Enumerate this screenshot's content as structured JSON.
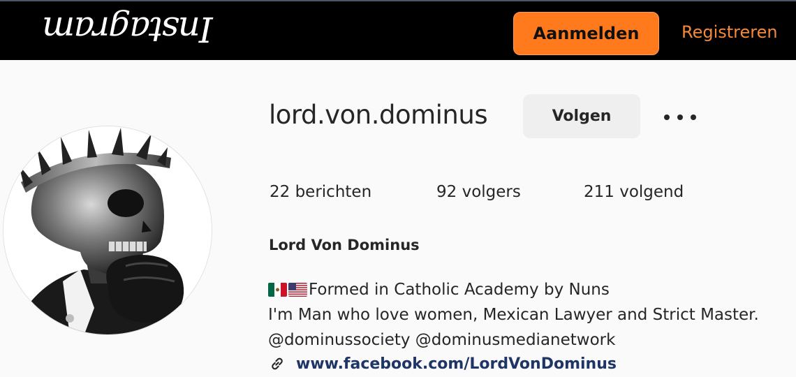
{
  "header": {
    "logo_text": "Instagram",
    "login_label": "Aanmelden",
    "register_label": "Registreren"
  },
  "profile": {
    "username": "lord.von.dominus",
    "follow_label": "Volgen",
    "more_icon": "more-options-icon",
    "stats": {
      "posts": "22 berichten",
      "followers": "92 volgers",
      "following": "211 volgend"
    },
    "full_name": "Lord Von Dominus",
    "bio": {
      "line1": "Formed in Catholic Academy by Nuns",
      "line1_flags": [
        "mexico-flag",
        "usa-flag"
      ],
      "line2": "I'm Man who love women, Mexican Lawyer and Strict Master.",
      "mention1": "@dominussociety",
      "mention2": "@dominusmedianetwork"
    },
    "website": "www.facebook.com/LordVonDominus",
    "avatar_description": "skull-with-crown-avatar"
  },
  "colors": {
    "topbar_bg": "#000000",
    "login_button_bg": "#ff7a1c",
    "register_text": "#f5893a",
    "follow_button_bg": "#efefef",
    "link_color": "#1f3566",
    "page_bg": "#fafafa"
  }
}
